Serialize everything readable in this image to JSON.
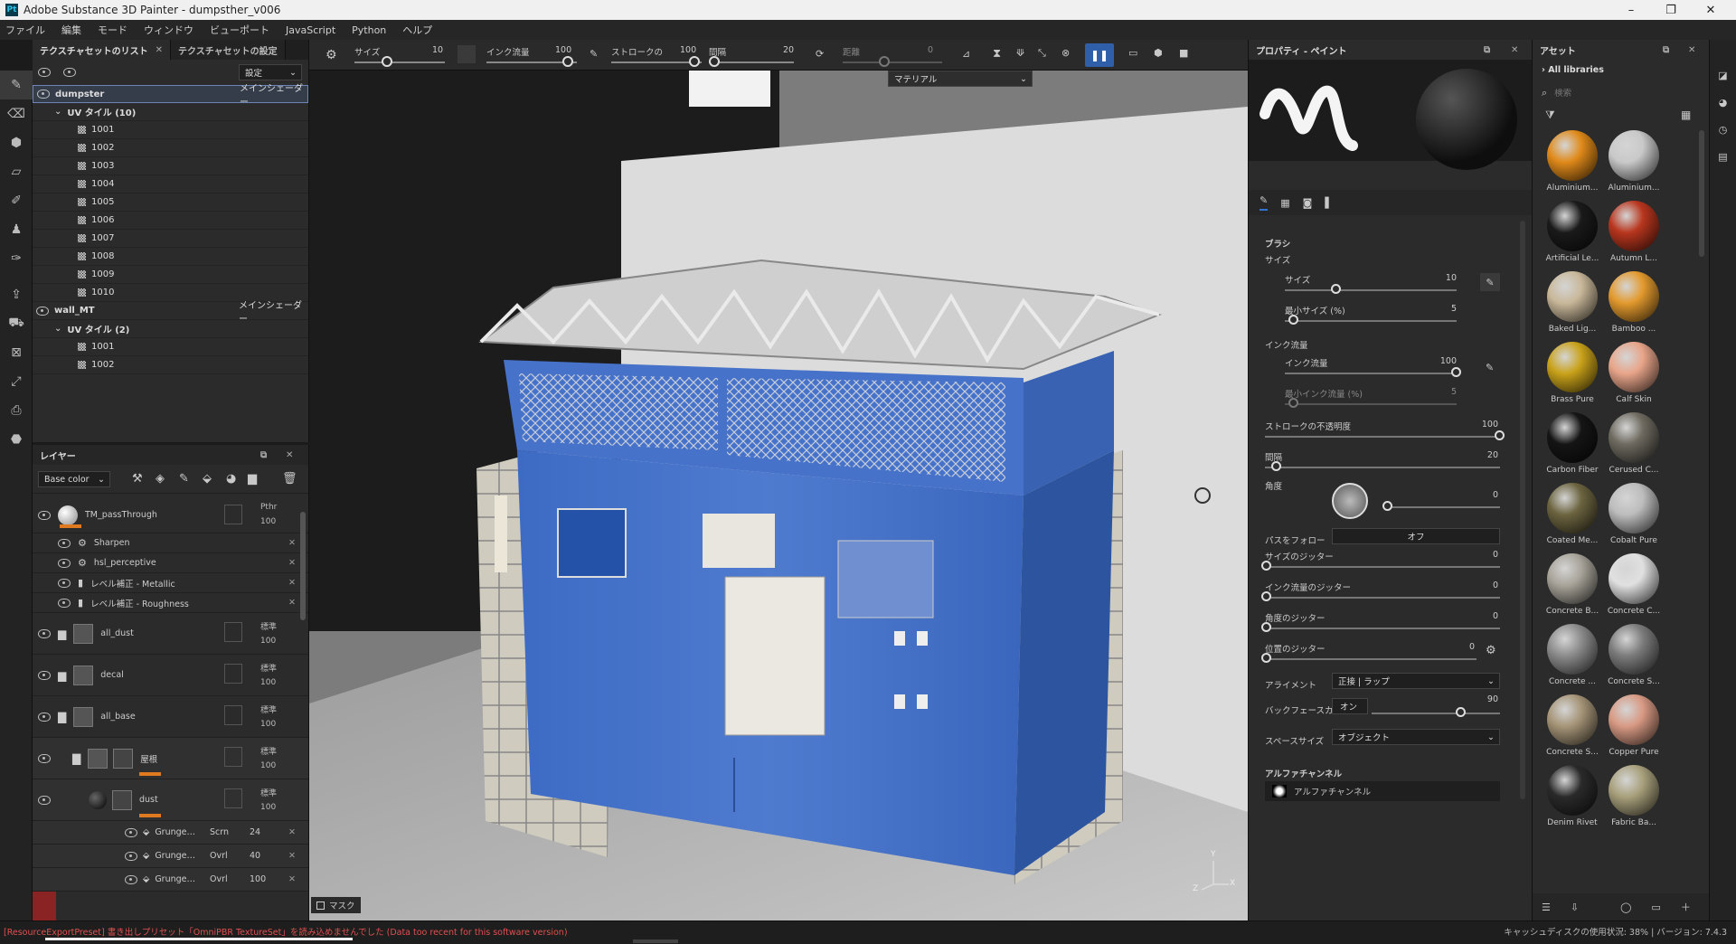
{
  "window": {
    "title": "Adobe Substance 3D Painter - dumpsther_v006",
    "logo": "Pt"
  },
  "menu": [
    "ファイル",
    "編集",
    "モード",
    "ウィンドウ",
    "ビューポート",
    "JavaScript",
    "Python",
    "ヘルプ"
  ],
  "texture_sets": {
    "tab_list": "テクスチャセットのリスト",
    "tab_settings": "テクスチャセットの設定",
    "settings_dropdown": "設定",
    "sets": [
      {
        "name": "dumpster",
        "shader": "メインシェーダー",
        "uv_label": "UV タイル (10)",
        "tiles": [
          "1001",
          "1002",
          "1003",
          "1004",
          "1005",
          "1006",
          "1007",
          "1008",
          "1009",
          "1010"
        ]
      },
      {
        "name": "wall_MT",
        "shader": "メインシェーダー",
        "uv_label": "UV タイル (2)",
        "tiles": [
          "1001",
          "1002"
        ]
      }
    ]
  },
  "layers": {
    "title": "レイヤー",
    "channel": "Base color",
    "rows": [
      {
        "name": "TM_passThrough",
        "blend": "Pthr",
        "opacity": "100"
      },
      {
        "name": "Sharpen"
      },
      {
        "name": "hsl_perceptive"
      },
      {
        "name": "レベル補正 - Metallic"
      },
      {
        "name": "レベル補正 - Roughness"
      },
      {
        "name": "all_dust",
        "blend": "標準",
        "opacity": "100"
      },
      {
        "name": "decal",
        "blend": "標準",
        "opacity": "100"
      },
      {
        "name": "all_base",
        "blend": "標準",
        "opacity": "100"
      },
      {
        "name": "屋根",
        "blend": "標準",
        "opacity": "100"
      },
      {
        "name": "dust",
        "blend": "標準",
        "opacity": "100"
      },
      {
        "name": "Grunge…",
        "blend": "Scrn",
        "opacity": "24"
      },
      {
        "name": "Grunge…",
        "blend": "Ovrl",
        "opacity": "40"
      },
      {
        "name": "Grunge…",
        "blend": "Ovrl",
        "opacity": "100"
      }
    ]
  },
  "toolbar": {
    "size_label": "サイズ",
    "size_value": "10",
    "flow_label": "インク流量",
    "flow_value": "100",
    "stroke_label": "ストロークの",
    "stroke_value": "100",
    "spacing_label": "間隔",
    "spacing_value": "20",
    "distance_label": "距離",
    "distance_value": "0"
  },
  "viewport": {
    "material_dropdown": "マテリアル",
    "mask_label": "マスク",
    "axis_y": "Y",
    "axis_z": "Z",
    "axis_x": "X"
  },
  "properties": {
    "title": "プロパティ - ペイント",
    "section_brush": "ブラシ",
    "size_group": "サイズ",
    "size": {
      "label": "サイズ",
      "value": "10",
      "fraction": 0.3
    },
    "min_size": {
      "label": "最小サイズ (%)",
      "value": "5",
      "fraction": 0.05
    },
    "flow_group": "インク流量",
    "flow": {
      "label": "インク流量",
      "value": "100",
      "fraction": 1.0
    },
    "min_flow": {
      "label": "最小インク流量 (%)",
      "value": "5",
      "fraction": 0.05
    },
    "stroke_opacity": {
      "label": "ストロークの不透明度",
      "value": "100",
      "fraction": 1.0
    },
    "spacing": {
      "label": "間隔",
      "value": "20",
      "fraction": 0.05
    },
    "angle": {
      "label": "角度",
      "value": "0"
    },
    "follow_path": {
      "label": "パスをフォロー",
      "value": "オフ"
    },
    "size_jitter": {
      "label": "サイズのジッター",
      "value": "0"
    },
    "flow_jitter": {
      "label": "インク流量のジッター",
      "value": "0"
    },
    "angle_jitter": {
      "label": "角度のジッター",
      "value": "0"
    },
    "pos_jitter": {
      "label": "位置のジッター",
      "value": "0"
    },
    "alignment": {
      "label": "アライメント",
      "value": "正接 | ラップ"
    },
    "backface": {
      "label": "バックフェースカリング",
      "toggle": "オン",
      "value": "90",
      "fraction": 0.7
    },
    "space_size": {
      "label": "スペースサイズ",
      "value": "オブジェクト"
    },
    "alpha_section": "アルファチャンネル",
    "alpha_item": "アルファチャンネル"
  },
  "assets": {
    "title": "アセット",
    "libraries": "All libraries",
    "search_placeholder": "検索",
    "items": [
      {
        "name": "Aluminium...",
        "color": "#e08a1a"
      },
      {
        "name": "Aluminium...",
        "color": "#c9c9c9"
      },
      {
        "name": "Artificial Le...",
        "color": "#1a1a1a"
      },
      {
        "name": "Autumn L...",
        "color": "#b8361e"
      },
      {
        "name": "Baked Lig...",
        "color": "#c9b89a"
      },
      {
        "name": "Bamboo ...",
        "color": "#e39a2e"
      },
      {
        "name": "Brass Pure",
        "color": "#c9a21a"
      },
      {
        "name": "Calf Skin",
        "color": "#e8a58a"
      },
      {
        "name": "Carbon Fiber",
        "color": "#151515"
      },
      {
        "name": "Cerused C...",
        "color": "#6e6a60"
      },
      {
        "name": "Coated Me...",
        "color": "#6c6440"
      },
      {
        "name": "Cobalt Pure",
        "color": "#bdbdbd"
      },
      {
        "name": "Concrete B...",
        "color": "#a8a49a"
      },
      {
        "name": "Concrete C...",
        "color": "#e0e0e0"
      },
      {
        "name": "Concrete ...",
        "color": "#8c8c8c"
      },
      {
        "name": "Concrete S...",
        "color": "#7c7c7c"
      },
      {
        "name": "Concrete S...",
        "color": "#a69578"
      },
      {
        "name": "Copper Pure",
        "color": "#d89a84"
      },
      {
        "name": "Denim Rivet",
        "color": "#2a2a2a"
      },
      {
        "name": "Fabric Ba...",
        "color": "#a8a07c"
      }
    ]
  },
  "status": {
    "message": "[ResourceExportPreset] 書き出しプリセット「OmniPBR TextureSet」を読み込めませんでした (Data too recent for this software version)",
    "cache": "キャッシュディスクの使用状況: 38% | バージョン: 7.4.3"
  }
}
